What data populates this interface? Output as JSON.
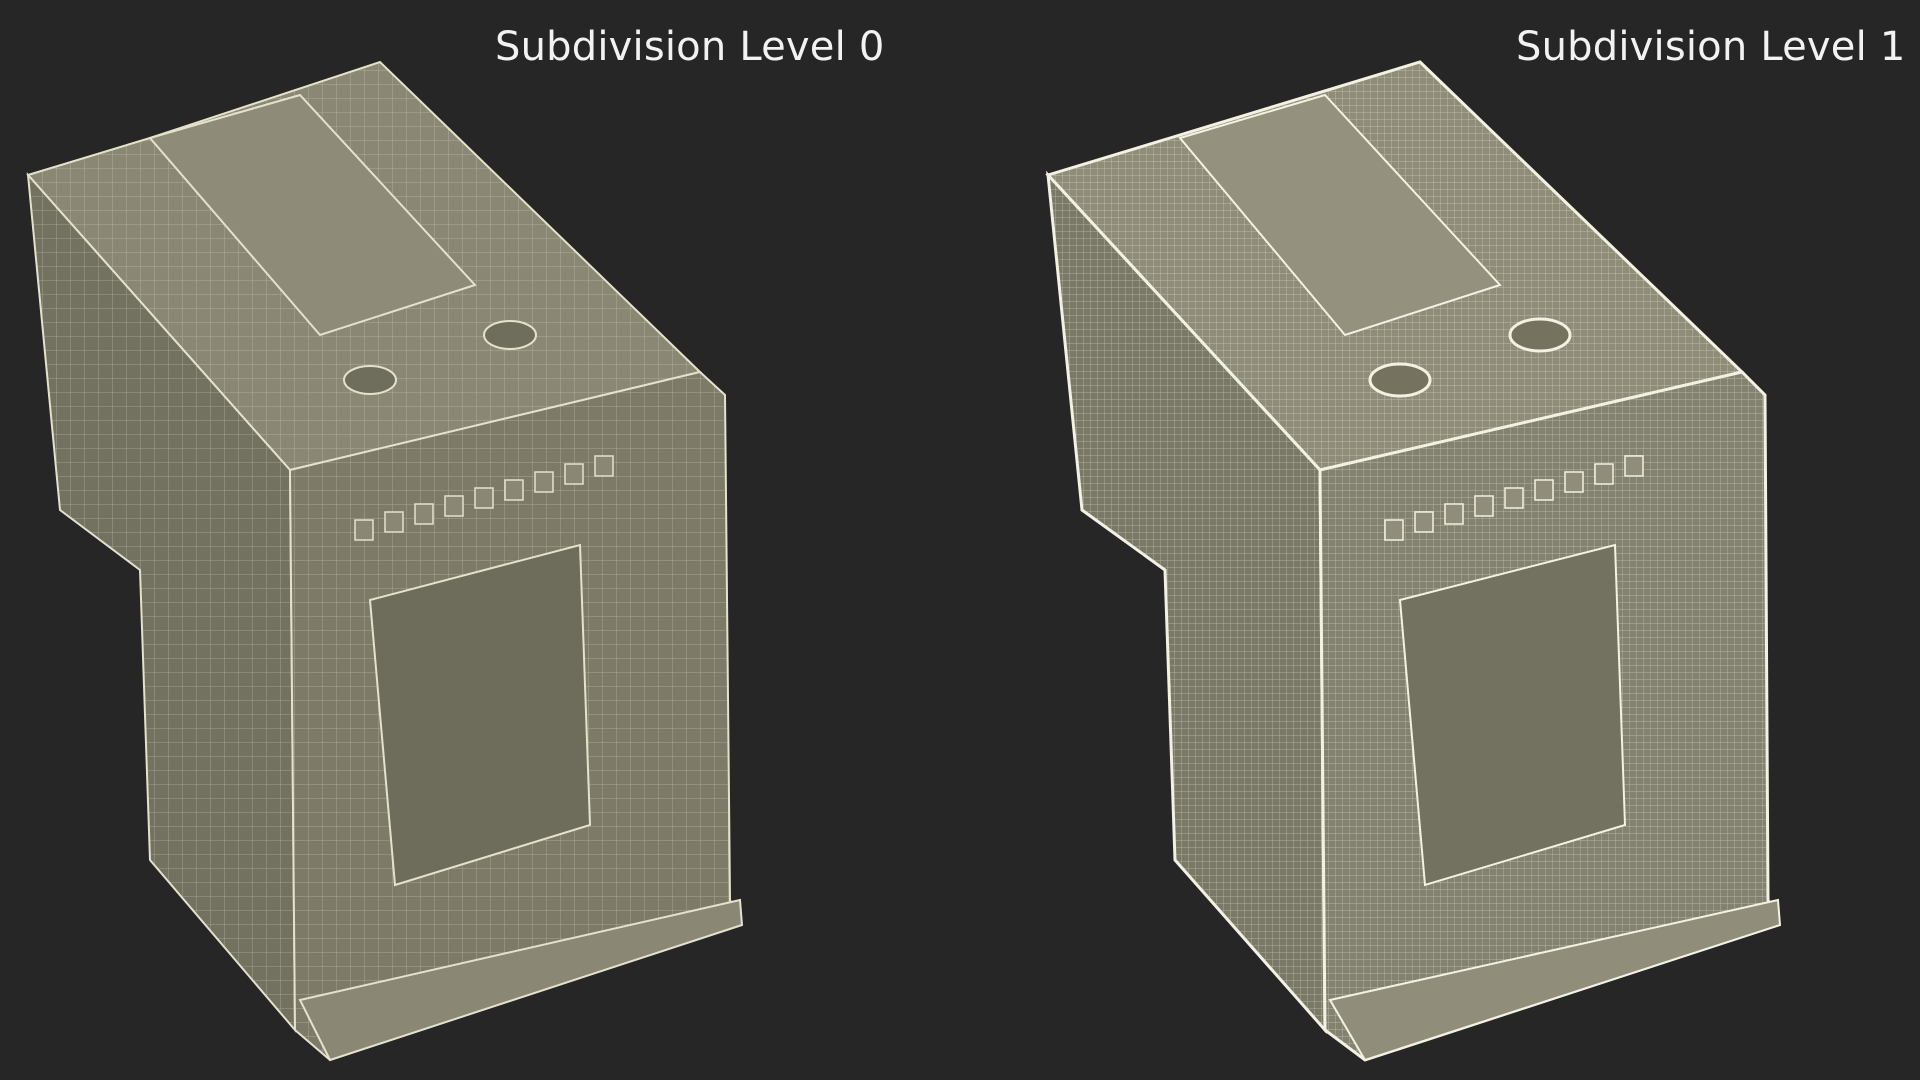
{
  "labels": {
    "left": "Subdivision Level 0",
    "right": "Subdivision Level 1"
  },
  "colors": {
    "background": "#262626",
    "mesh_fill": "#7d7b68",
    "wire_left": "#dedcc4",
    "wire_right": "#f0eedd",
    "label_text": "#f2f2f2"
  }
}
